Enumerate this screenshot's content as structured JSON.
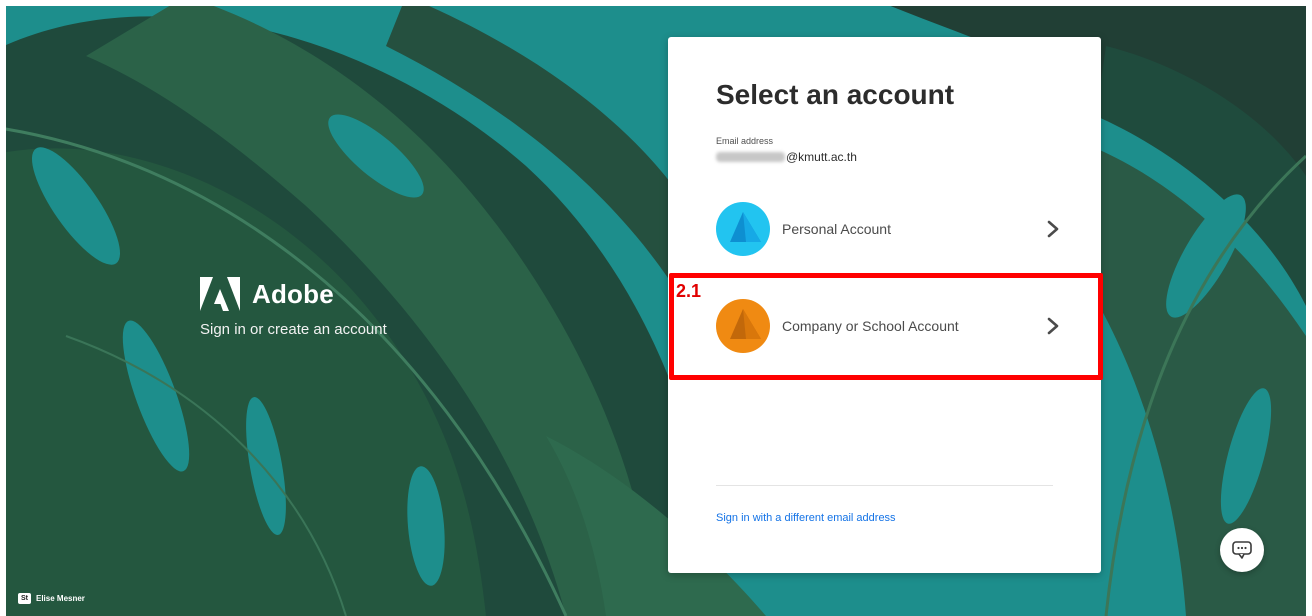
{
  "brand": {
    "name": "Adobe",
    "subtitle": "Sign in or create an account"
  },
  "card": {
    "title": "Select an account",
    "email_label": "Email address",
    "email_domain": "@kmutt.ac.th",
    "accounts": [
      {
        "label": "Personal Account",
        "icon": "personal-account-icon",
        "color": "#22c4f0"
      },
      {
        "label": "Company or School Account",
        "icon": "company-account-icon",
        "color": "#f08a12"
      }
    ],
    "different_email_link": "Sign in with a different email address"
  },
  "annotation": {
    "step": "2.1",
    "color": "#ff0000"
  },
  "photo_credit": {
    "badge": "St",
    "name": "Elise Mesner"
  },
  "chat": {
    "icon": "chat-bubble-icon"
  },
  "colors": {
    "accent_link": "#1473e6",
    "background_teal": "#1e8f8d"
  }
}
